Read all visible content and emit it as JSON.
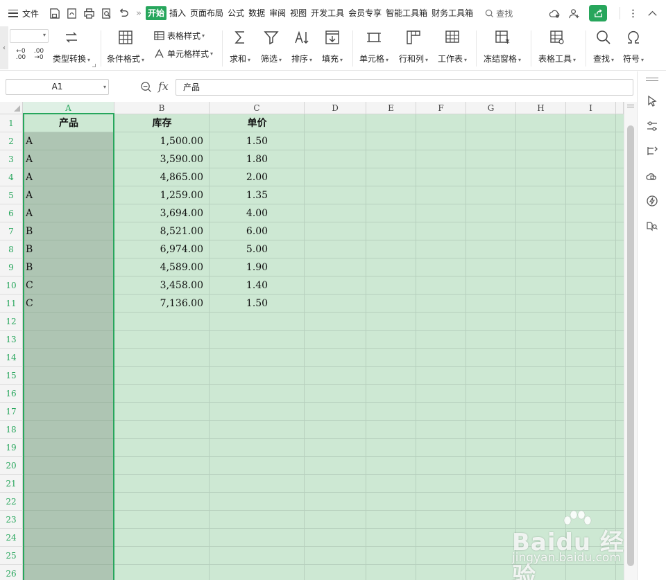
{
  "menubar": {
    "file_label": "文件",
    "tabs": [
      "开始",
      "插入",
      "页面布局",
      "公式",
      "数据",
      "审阅",
      "视图",
      "开发工具",
      "会员专享",
      "智能工具箱",
      "财务工具箱"
    ],
    "active_tab": "开始",
    "search_label": "查找",
    "overflow": "»"
  },
  "ribbon": {
    "type_convert": "类型转换",
    "cond_format": "条件格式",
    "table_style": "表格样式",
    "cell_style": "单元格样式",
    "sum": "求和",
    "filter": "筛选",
    "sort": "排序",
    "fill": "填充",
    "cell": "单元格",
    "row_col": "行和列",
    "worksheet": "工作表",
    "freeze": "冻结窗格",
    "table_tools": "表格工具",
    "find": "查找",
    "symbol": "符号",
    "dec_add": "←0 .00",
    "dec_sub": ".00 →0"
  },
  "formula_bar": {
    "name_box": "A1",
    "fx": "fx",
    "content": "产品"
  },
  "grid": {
    "columns": [
      "A",
      "B",
      "C",
      "D",
      "E",
      "F",
      "G",
      "H",
      "I"
    ],
    "selected_column": "A",
    "row_numbers": [
      "1",
      "2",
      "3",
      "4",
      "5",
      "6",
      "7",
      "8",
      "9",
      "10",
      "11",
      "12",
      "13",
      "14",
      "15",
      "16",
      "17",
      "18",
      "19",
      "20",
      "21",
      "22",
      "23",
      "24",
      "25",
      "26"
    ],
    "headers": [
      "产品",
      "库存",
      "单价"
    ],
    "rows": [
      [
        "A",
        "1,500.00",
        "1.50"
      ],
      [
        "A",
        "3,590.00",
        "1.80"
      ],
      [
        "A",
        "4,865.00",
        "2.00"
      ],
      [
        "A",
        "1,259.00",
        "1.35"
      ],
      [
        "A",
        "3,694.00",
        "4.00"
      ],
      [
        "B",
        "8,521.00",
        "6.00"
      ],
      [
        "B",
        "6,974.00",
        "5.00"
      ],
      [
        "B",
        "4,589.00",
        "1.90"
      ],
      [
        "C",
        "3,458.00",
        "1.40"
      ],
      [
        "C",
        "7,136.00",
        "1.50"
      ]
    ]
  },
  "watermark": {
    "brand": "Baidu 经验",
    "url": "jingyan.baidu.com"
  },
  "colors": {
    "accent": "#27a65c",
    "sheet_bg": "#cde8d3",
    "selected_col_bg": "#aec5b3"
  }
}
